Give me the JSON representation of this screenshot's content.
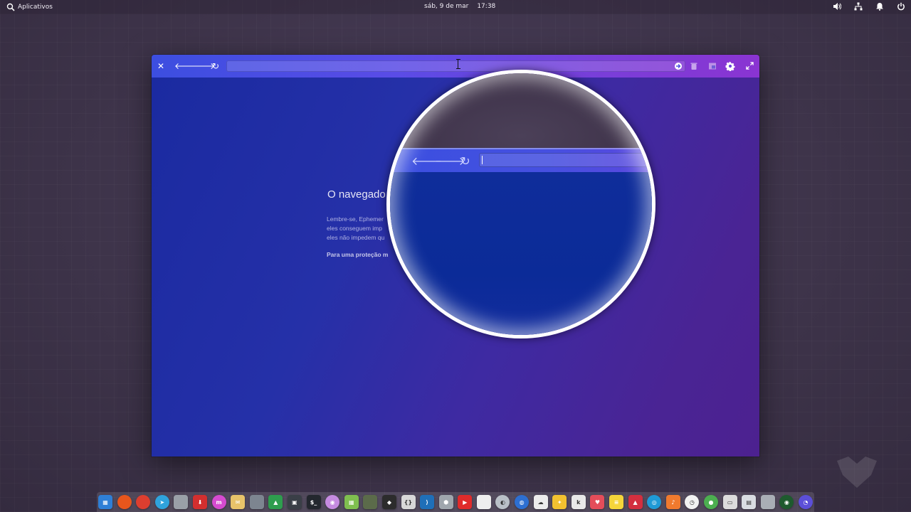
{
  "panel": {
    "applications_label": "Aplicativos",
    "date": "sáb, 9 de mar",
    "time": "17:38",
    "indicators": [
      "volume-icon",
      "network-icon",
      "notifications-icon",
      "power-icon"
    ]
  },
  "browser": {
    "url_value": "",
    "content": {
      "title": "O navegado",
      "line1": "Lembre-se, Ephemer",
      "line2": "eles conseguem imp",
      "line3": "eles não impedem qu",
      "strong": "Para uma proteção m"
    }
  },
  "magnifier": {
    "url_value": ""
  },
  "dock": {
    "items": [
      {
        "name": "multitasking",
        "glyph": "▦",
        "color": "#2f7fd6"
      },
      {
        "name": "firefox",
        "glyph": "",
        "color": "#e8561c"
      },
      {
        "name": "chrome",
        "glyph": "",
        "color": "#dd3e2f"
      },
      {
        "name": "telegram",
        "glyph": "➤",
        "color": "#2fa3dc"
      },
      {
        "name": "files",
        "glyph": "",
        "color": "#9aa0a8"
      },
      {
        "name": "appcenter",
        "glyph": "⬇",
        "color": "#d32f2f"
      },
      {
        "name": "hub",
        "glyph": "m",
        "color": "#d64bd0"
      },
      {
        "name": "mail",
        "glyph": "✉",
        "color": "#e8c36a"
      },
      {
        "name": "calculator",
        "glyph": "",
        "color": "#7d8590"
      },
      {
        "name": "google-drive",
        "glyph": "▲",
        "color": "#2e9d4e"
      },
      {
        "name": "screenshot",
        "glyph": "▣",
        "color": "#3a3f47"
      },
      {
        "name": "terminal",
        "glyph": "$_",
        "color": "#23272e"
      },
      {
        "name": "owl-app",
        "glyph": "◉",
        "color": "#c58be0"
      },
      {
        "name": "spreadsheet",
        "glyph": "▦",
        "color": "#7fbf4f"
      },
      {
        "name": "turtle-app",
        "glyph": "",
        "color": "#5b6b4a"
      },
      {
        "name": "inkscape",
        "glyph": "◆",
        "color": "#2c2c2c"
      },
      {
        "name": "code-editor",
        "glyph": "{}",
        "color": "#d8d8d8"
      },
      {
        "name": "vscode",
        "glyph": "⟩",
        "color": "#1f6fb8"
      },
      {
        "name": "cube-app",
        "glyph": "⬢",
        "color": "#9fa6ad"
      },
      {
        "name": "youtube",
        "glyph": "▶",
        "color": "#e02b2b"
      },
      {
        "name": "document",
        "glyph": "",
        "color": "#eeeeee"
      },
      {
        "name": "disk-app",
        "glyph": "◐",
        "color": "#b9c0c7"
      },
      {
        "name": "browser-globe",
        "glyph": "◍",
        "color": "#2d6fd1"
      },
      {
        "name": "weather",
        "glyph": "☁",
        "color": "#ececec"
      },
      {
        "name": "idea-app",
        "glyph": "✦",
        "color": "#f2c230"
      },
      {
        "name": "kindle",
        "glyph": "k",
        "color": "#e8e8e8"
      },
      {
        "name": "pocket",
        "glyph": "♥",
        "color": "#e44d5a"
      },
      {
        "name": "notes",
        "glyph": "≡",
        "color": "#f5d53a"
      },
      {
        "name": "vector-app",
        "glyph": "▲",
        "color": "#d32f3f"
      },
      {
        "name": "headset-app",
        "glyph": "◎",
        "color": "#1f9ad6"
      },
      {
        "name": "music",
        "glyph": "♪",
        "color": "#f07a2e"
      },
      {
        "name": "clock",
        "glyph": "◷",
        "color": "#f2f2f2"
      },
      {
        "name": "media-player",
        "glyph": "●",
        "color": "#4caf50"
      },
      {
        "name": "id-card",
        "glyph": "▭",
        "color": "#dcdcdc"
      },
      {
        "name": "calendar-badge",
        "glyph": "▤",
        "color": "#d9dde2"
      },
      {
        "name": "trash",
        "glyph": "",
        "color": "#a9aeb5"
      },
      {
        "name": "lens-app",
        "glyph": "◉",
        "color": "#1e5a2e"
      },
      {
        "name": "ephemeral-browser",
        "glyph": "◔",
        "color": "#5c4fd8"
      }
    ]
  }
}
